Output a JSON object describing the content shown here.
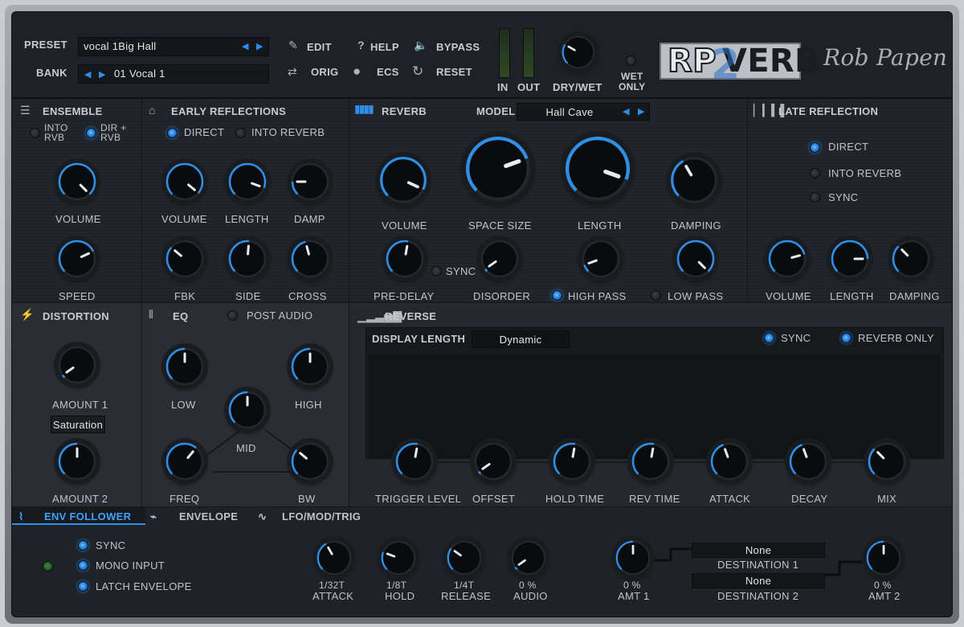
{
  "header": {
    "preset_label": "PRESET",
    "preset_value": "vocal 1Big Hall",
    "bank_label": "BANK",
    "bank_value": "01 Vocal 1",
    "edit": "EDIT",
    "help": "HELP",
    "bypass": "BYPASS",
    "orig": "ORIG",
    "ecs": "ECS",
    "reset": "RESET",
    "in": "IN",
    "out": "OUT",
    "drywet": "DRY/WET",
    "wet_only": "WET\nONLY",
    "logo_rp": "RP",
    "logo_verb": "VERB",
    "logo_2": "2",
    "brand": "Rob Papen"
  },
  "ensemble": {
    "title": "ENSEMBLE",
    "into_rvb": "INTO\nRVB",
    "dir_rvb": "DIR +\nRVB",
    "volume": "VOLUME",
    "speed": "SPEED"
  },
  "early": {
    "title": "EARLY REFLECTIONS",
    "direct": "DIRECT",
    "into_reverb": "INTO REVERB",
    "volume": "VOLUME",
    "length": "LENGTH",
    "damp": "DAMP",
    "fbk": "FBK",
    "side": "SIDE",
    "cross": "CROSS"
  },
  "reverb": {
    "title": "REVERB",
    "model_label": "MODEL",
    "model_value": "Hall Cave",
    "volume": "VOLUME",
    "space_size": "SPACE SIZE",
    "length": "LENGTH",
    "damping": "DAMPING",
    "pre_delay": "PRE-DELAY",
    "sync": "SYNC",
    "disorder": "DISORDER",
    "high_pass": "HIGH PASS",
    "low_pass": "LOW PASS"
  },
  "late": {
    "title": "LATE REFLECTION",
    "direct": "DIRECT",
    "into_reverb": "INTO REVERB",
    "sync": "SYNC",
    "volume": "VOLUME",
    "length": "LENGTH",
    "damping": "DAMPING"
  },
  "distortion": {
    "title": "DISTORTION",
    "amount1": "AMOUNT 1",
    "type_value": "Saturation",
    "amount2": "AMOUNT 2"
  },
  "eq": {
    "title": "EQ",
    "post_audio": "POST AUDIO",
    "low": "LOW",
    "high": "HIGH",
    "mid": "MID",
    "freq": "FREQ",
    "bw": "BW"
  },
  "reverse": {
    "title": "REVERSE",
    "display_length_label": "DISPLAY LENGTH",
    "display_length_value": "Dynamic",
    "sync": "SYNC",
    "reverb_only": "REVERB ONLY",
    "trigger_level": "TRIGGER LEVEL",
    "offset": "OFFSET",
    "hold_time": "HOLD TIME",
    "rev_time": "REV TIME",
    "attack": "ATTACK",
    "decay": "DECAY",
    "mix": "MIX"
  },
  "bottom": {
    "tab_env": "ENV FOLLOWER",
    "tab_envelope": "ENVELOPE",
    "tab_lfo": "LFO/MOD/TRIG",
    "sync": "SYNC",
    "mono_input": "MONO INPUT",
    "latch_envelope": "LATCH ENVELOPE",
    "attack_val": "1/32T",
    "attack": "ATTACK",
    "hold_val": "1/8T",
    "hold": "HOLD",
    "release_val": "1/4T",
    "release": "RELEASE",
    "audio_val": "0 %",
    "audio": "AUDIO",
    "amt1_val": "0 %",
    "amt1": "AMT 1",
    "dest1_value": "None",
    "dest1": "DESTINATION 1",
    "dest2_value": "None",
    "dest2": "DESTINATION 2",
    "amt2_val": "0 %",
    "amt2": "AMT 2"
  },
  "colors": {
    "accent": "#2f8fe8",
    "panel": "#212429",
    "frame": "#8a8e93"
  }
}
